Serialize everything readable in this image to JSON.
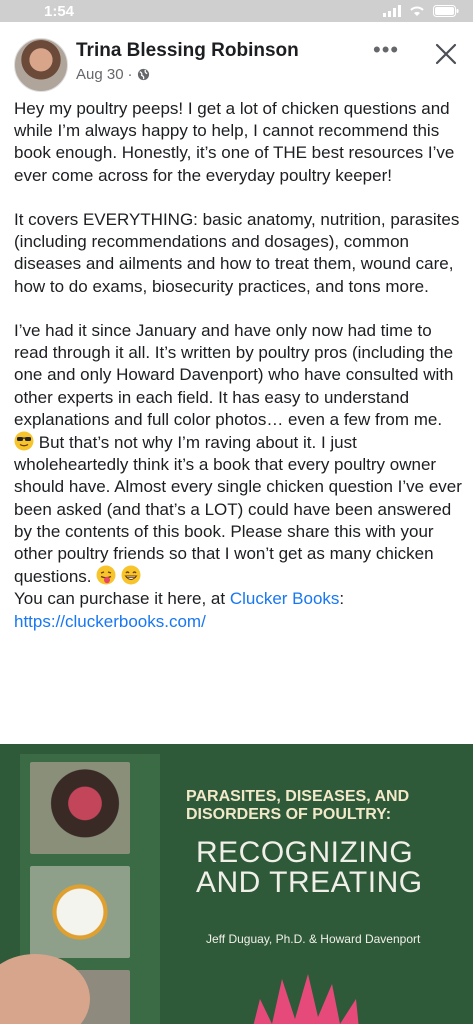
{
  "status": {
    "time": "1:54"
  },
  "post": {
    "author": "Trina Blessing Robinson",
    "date": "Aug 30",
    "separator": "·",
    "more_label": "•••",
    "p1": "Hey my poultry peeps! I get a lot of chicken questions and while I’m always happy to help, I cannot recommend this book enough. Honestly, it’s one of THE best resources I’ve ever come across for the everyday poultry keeper!",
    "p2": "It covers EVERYTHING: basic anatomy, nutrition, parasites (including recommendations and dosages), common diseases and ailments and how to treat them, wound care, how to do exams, biosecurity practices, and tons more.",
    "p3a": "I’ve had it since January and have only now had time to read through it all. It’s written by poultry pros (including the one and only Howard Davenport) who have consulted with other experts in each field. It has easy to understand explanations and full color photos… even a few from me.",
    "p3b": "But that’s not why I’m raving about it. I just wholeheartedly think it’s a book that every poultry owner should have. Almost every single chicken question I’ve ever been asked (and that’s a LOT) could have been answered by the contents of this book. Please share this with your other poultry friends so that I won’t get as many chicken questions.",
    "p4_prefix": "You can purchase it here, at",
    "link_text": "Clucker Books",
    "colon": ":",
    "url": "https://cluckerbooks.com/"
  },
  "book": {
    "title_line1": "PARASITES, DISEASES, AND",
    "title_line2": "DISORDERS OF POULTRY:",
    "subtitle_line1": "RECOGNIZING",
    "subtitle_line2": "AND TREATING",
    "authors": "Jeff Duguay, Ph.D. & Howard Davenport"
  },
  "colors": {
    "link": "#1877f2",
    "meta": "#65676b",
    "text": "#1c1e21"
  },
  "icons": [
    "signal-icon",
    "wifi-icon",
    "battery-icon",
    "globe-icon",
    "close-icon",
    "sunglasses-emoji",
    "tongue-emoji",
    "grin-emoji"
  ]
}
